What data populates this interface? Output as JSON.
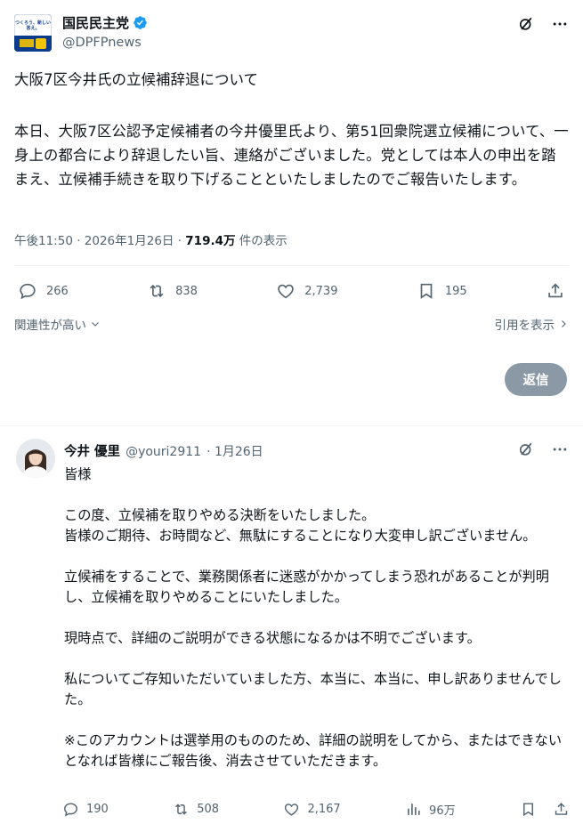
{
  "post": {
    "author_name": "国民民主党",
    "author_handle": "@DPFPnews",
    "avatar_text": "つくろう、新しい答え。",
    "title": "大阪7区今井氏の立候補辞退について",
    "body": "本日、大阪7区公認予定候補者の今井優里氏より、第51回衆院選立候補について、一身上の都合により辞退したい旨、連絡がございました。党としては本人の申出を踏まえ、立候補手続きを取り下げることといたしましたのでご報告いたします。",
    "time": "午後11:50 · 2026年1月26日 · ",
    "views_count": "719.4万",
    "views_label": " 件の表示",
    "stats": {
      "replies": "266",
      "reposts": "838",
      "likes": "2,739",
      "bookmarks": "195"
    }
  },
  "sort": {
    "relevance_label": "関連性が高い",
    "quotes_label": "引用を表示"
  },
  "reply_button": "返信",
  "reply": {
    "author_name": "今井 優里",
    "author_handle": "@youri2911",
    "date": "· 1月26日",
    "paragraphs": [
      "皆様",
      "この度、立候補を取りやめる決断をいたしました。\n皆様のご期待、お時間など、無駄にすることになり大変申し訳ございません。",
      "立候補をすることで、業務関係者に迷惑がかかってしまう恐れがあることが判明し、立候補を取りやめることにいたしました。",
      "現時点で、詳細のご説明ができる状態になるかは不明でございます。",
      "私についてご存知いただいていました方、本当に、本当に、申し訳ありませんでした。",
      "※このアカウントは選挙用のもののため、詳細の説明をしてから、またはできないとなれば皆様にご報告後、消去させていただきます。"
    ],
    "stats": {
      "replies": "190",
      "reposts": "508",
      "likes": "2,167",
      "views": "96万"
    }
  },
  "colors": {
    "verified": "#1d9bf0",
    "muted": "#536471",
    "reply_button_bg": "#8b98a5"
  }
}
